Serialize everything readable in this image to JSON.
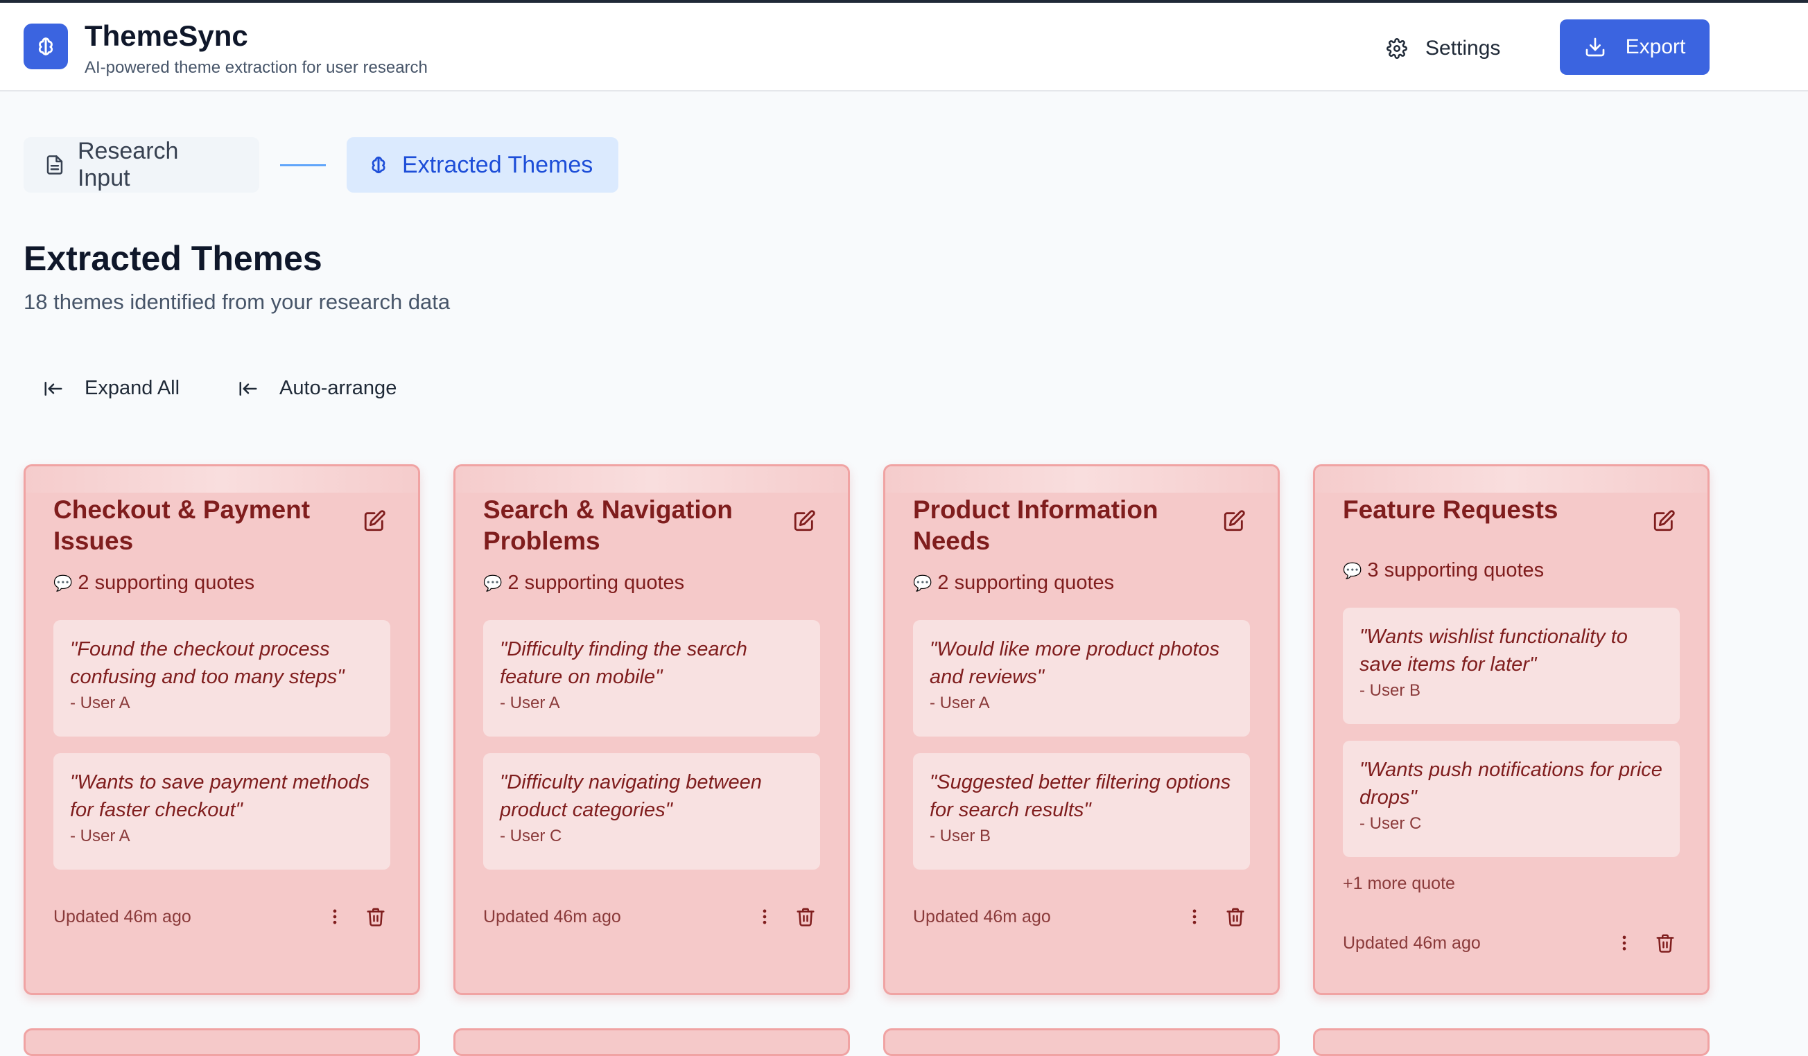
{
  "app": {
    "title": "ThemeSync",
    "subtitle": "AI-powered theme extraction for user research",
    "settings_label": "Settings",
    "export_label": "Export"
  },
  "colors": {
    "primary": "#3b64e0",
    "card_bg": "#f5c9c9",
    "card_border": "#f0a3a3",
    "card_text": "#7f1d1d",
    "quote_bg": "#f8e1e1"
  },
  "steps": [
    {
      "label": "Research Input",
      "icon": "document-icon"
    },
    {
      "label": "Extracted Themes",
      "icon": "brain-icon"
    }
  ],
  "page": {
    "title": "Extracted Themes",
    "subtitle": "18 themes identified from your research data"
  },
  "toolbar": {
    "expand_all": "Expand All",
    "auto_arrange": "Auto-arrange"
  },
  "themes": [
    {
      "title": "Checkout & Payment Issues",
      "quote_count": "2 supporting quotes",
      "quotes": [
        {
          "text": "\"Found the checkout process confusing and too many steps\"",
          "user": "- User A"
        },
        {
          "text": "\"Wants to save payment methods for faster checkout\"",
          "user": "- User A"
        }
      ],
      "more": "",
      "updated": "Updated 46m ago"
    },
    {
      "title": "Search & Navigation Problems",
      "quote_count": "2 supporting quotes",
      "quotes": [
        {
          "text": "\"Difficulty finding the search feature on mobile\"",
          "user": "- User A"
        },
        {
          "text": "\"Difficulty navigating between product categories\"",
          "user": "- User C"
        }
      ],
      "more": "",
      "updated": "Updated 46m ago"
    },
    {
      "title": "Product Information Needs",
      "quote_count": "2 supporting quotes",
      "quotes": [
        {
          "text": "\"Would like more product photos and reviews\"",
          "user": "- User A"
        },
        {
          "text": "\"Suggested better filtering options for search results\"",
          "user": "- User B"
        }
      ],
      "more": "",
      "updated": "Updated 46m ago"
    },
    {
      "title": "Feature Requests",
      "quote_count": "3 supporting quotes",
      "quotes": [
        {
          "text": "\"Wants wishlist functionality to save items for later\"",
          "user": "- User B"
        },
        {
          "text": "\"Wants push notifications for price drops\"",
          "user": "- User C"
        }
      ],
      "more": "+1 more quote",
      "updated": "Updated 46m ago"
    }
  ]
}
